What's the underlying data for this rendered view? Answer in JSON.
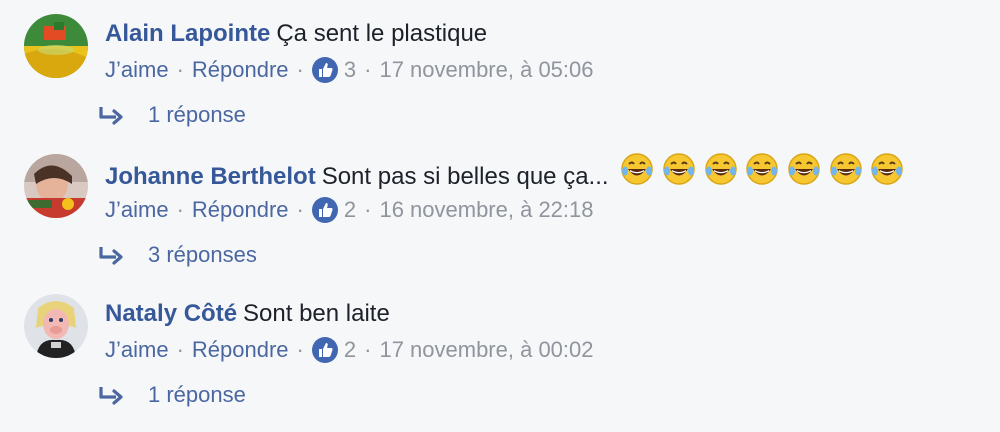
{
  "comments": [
    {
      "author": "Alain Lapointe",
      "text": "Ça sent le plastique",
      "emojis": [],
      "actions": {
        "like": "J’aime",
        "reply": "Répondre"
      },
      "reaction_count": "3",
      "timestamp": "17 novembre, à 05:06",
      "replies_label": "1 réponse"
    },
    {
      "author": "Johanne Berthelot",
      "text": "Sont pas si belles que ça...",
      "emojis": [
        "😂",
        "😂",
        "😂",
        "😂",
        "😂",
        "😂",
        "😂"
      ],
      "actions": {
        "like": "J’aime",
        "reply": "Répondre"
      },
      "reaction_count": "2",
      "timestamp": "16 novembre, à 22:18",
      "replies_label": "3 réponses"
    },
    {
      "author": "Nataly Côté",
      "text": "Sont ben laite",
      "emojis": [],
      "actions": {
        "like": "J’aime",
        "reply": "Répondre"
      },
      "reaction_count": "2",
      "timestamp": "17 novembre, à 00:02",
      "replies_label": "1 réponse"
    }
  ],
  "separator": "·",
  "colors": {
    "background": "#f6f7f9",
    "author": "#365899",
    "link": "#4b67a1",
    "meta": "#90949c",
    "like_icon": "#4267b2"
  }
}
